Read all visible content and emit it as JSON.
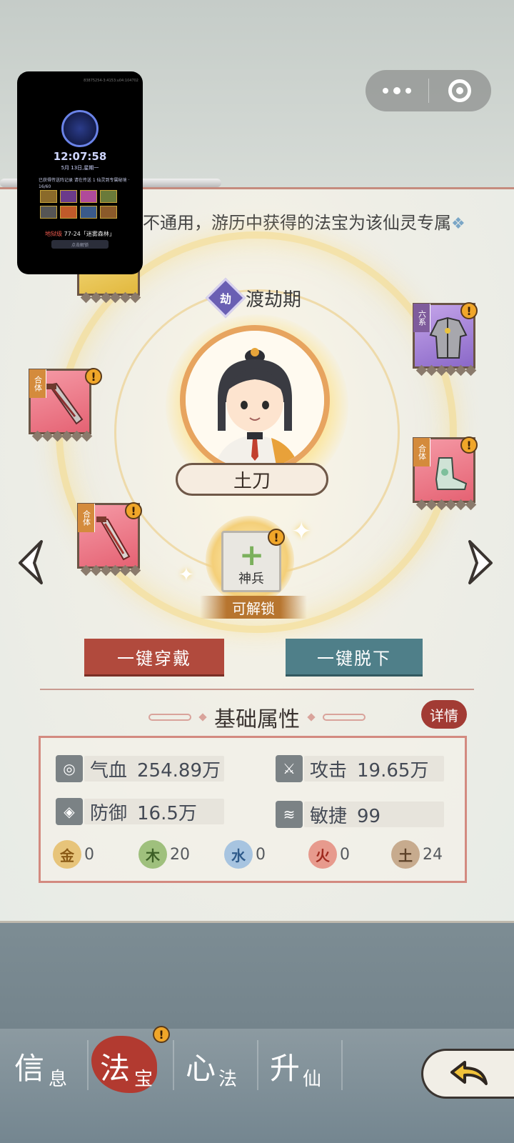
{
  "hint_text": "不通用，游历中获得的法宝为该仙灵专属",
  "rank": {
    "badge": "劫",
    "name": "渡劫期"
  },
  "character": {
    "name": "土刀"
  },
  "slots": [
    {
      "tag": "合体",
      "color": "pink",
      "alert": "!"
    },
    {
      "tag": "合体",
      "color": "pink",
      "alert": "!"
    },
    {
      "tag": "六系",
      "color": "purple",
      "alert": "!"
    },
    {
      "tag": "合体",
      "color": "pink",
      "alert": "!"
    }
  ],
  "shenbing": {
    "label": "神兵",
    "alert": "!",
    "unlock": "可解锁"
  },
  "buttons": {
    "wear_all": "一键穿戴",
    "remove_all": "一键脱下"
  },
  "attributes": {
    "title": "基础属性",
    "detail": "详情",
    "stats": [
      {
        "icon": "blood-drop-icon",
        "glyph": "◎",
        "label": "气血",
        "value": "254.89万"
      },
      {
        "icon": "attack-icon",
        "glyph": "⚔",
        "label": "攻击",
        "value": "19.65万"
      },
      {
        "icon": "shield-icon",
        "glyph": "◈",
        "label": "防御",
        "value": "16.5万"
      },
      {
        "icon": "agility-icon",
        "glyph": "≋",
        "label": "敏捷",
        "value": "99"
      }
    ],
    "elements": [
      {
        "icon": "metal-icon",
        "char": "金",
        "value": "0",
        "color": "#e7c47a"
      },
      {
        "icon": "wood-icon",
        "char": "木",
        "value": "20",
        "color": "#9fc07d"
      },
      {
        "icon": "water-icon",
        "char": "水",
        "value": "0",
        "color": "#a7c4e0"
      },
      {
        "icon": "fire-icon",
        "char": "火",
        "value": "0",
        "color": "#e79a8d"
      },
      {
        "icon": "earth-icon",
        "char": "土",
        "value": "24",
        "color": "#c7ab8e"
      }
    ]
  },
  "nav": {
    "tabs": [
      {
        "big": "信",
        "small": "息"
      },
      {
        "big": "法",
        "small": "宝",
        "alert": "!"
      },
      {
        "big": "心",
        "small": "法"
      },
      {
        "big": "升",
        "small": "仙"
      }
    ]
  },
  "thumbnail": {
    "header": "83875254-3:4153:u04:104702",
    "time": "12:07:58",
    "date": "5月 13日,星期一",
    "notice": "已获得传送阵记录 请在传送 1 仙灵到专属秘境 · 16/60",
    "hell_label": "地狱级",
    "hell_text": "77-24「迷雾森林」",
    "button": "点击解锁"
  },
  "colors": {
    "wear_button": "#b14a3d",
    "remove_button": "#4f7f89",
    "alert": "#f0a629",
    "active_tab": "#b23a30"
  }
}
